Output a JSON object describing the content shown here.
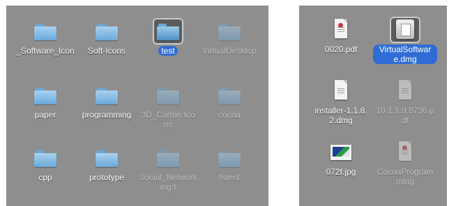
{
  "left_window": {
    "items": [
      {
        "name": "_Software_Icon",
        "type": "folder",
        "dim": false,
        "selected": false
      },
      {
        "name": "Soft-Icons",
        "type": "folder",
        "dim": false,
        "selected": false
      },
      {
        "name": "test",
        "type": "folder",
        "dim": false,
        "selected": true
      },
      {
        "name": "VirtualDesktop",
        "type": "folder",
        "dim": true,
        "selected": false
      },
      {
        "name": "paper",
        "type": "folder",
        "dim": false,
        "selected": false
      },
      {
        "name": "programming",
        "type": "folder",
        "dim": false,
        "selected": false
      },
      {
        "name": "3D_Carton Icons",
        "type": "folder",
        "dim": true,
        "selected": false
      },
      {
        "name": "cocoa",
        "type": "folder",
        "dim": true,
        "selected": false
      },
      {
        "name": "cpp",
        "type": "folder",
        "dim": false,
        "selected": false
      },
      {
        "name": "prototype",
        "type": "folder",
        "dim": false,
        "selected": false
      },
      {
        "name": "Social_Networking I",
        "type": "folder",
        "dim": true,
        "selected": false
      },
      {
        "name": "fstest",
        "type": "folder",
        "dim": true,
        "selected": false
      }
    ]
  },
  "right_window": {
    "items": [
      {
        "name": "0020.pdf",
        "type": "pdf-file",
        "dim": false,
        "selected": false
      },
      {
        "name": "VirtualSoftware.dmg",
        "type": "dmg-file",
        "dim": false,
        "selected": true
      },
      {
        "name": "installer-1.1.8.2.dmg",
        "type": "document-file",
        "dim": false,
        "selected": false
      },
      {
        "name": "10.1.1.9.8736.pdf",
        "type": "document-file",
        "dim": true,
        "selected": false
      },
      {
        "name": "072f.jpg",
        "type": "image-file",
        "dim": false,
        "selected": false
      },
      {
        "name": "CocoaProgramming",
        "type": "pdf-file",
        "dim": true,
        "selected": false
      }
    ]
  },
  "colors": {
    "window_background": "#8e8e8e",
    "selection_highlight": "#2f6cd6",
    "folder_blue": "#6aa7d8"
  }
}
